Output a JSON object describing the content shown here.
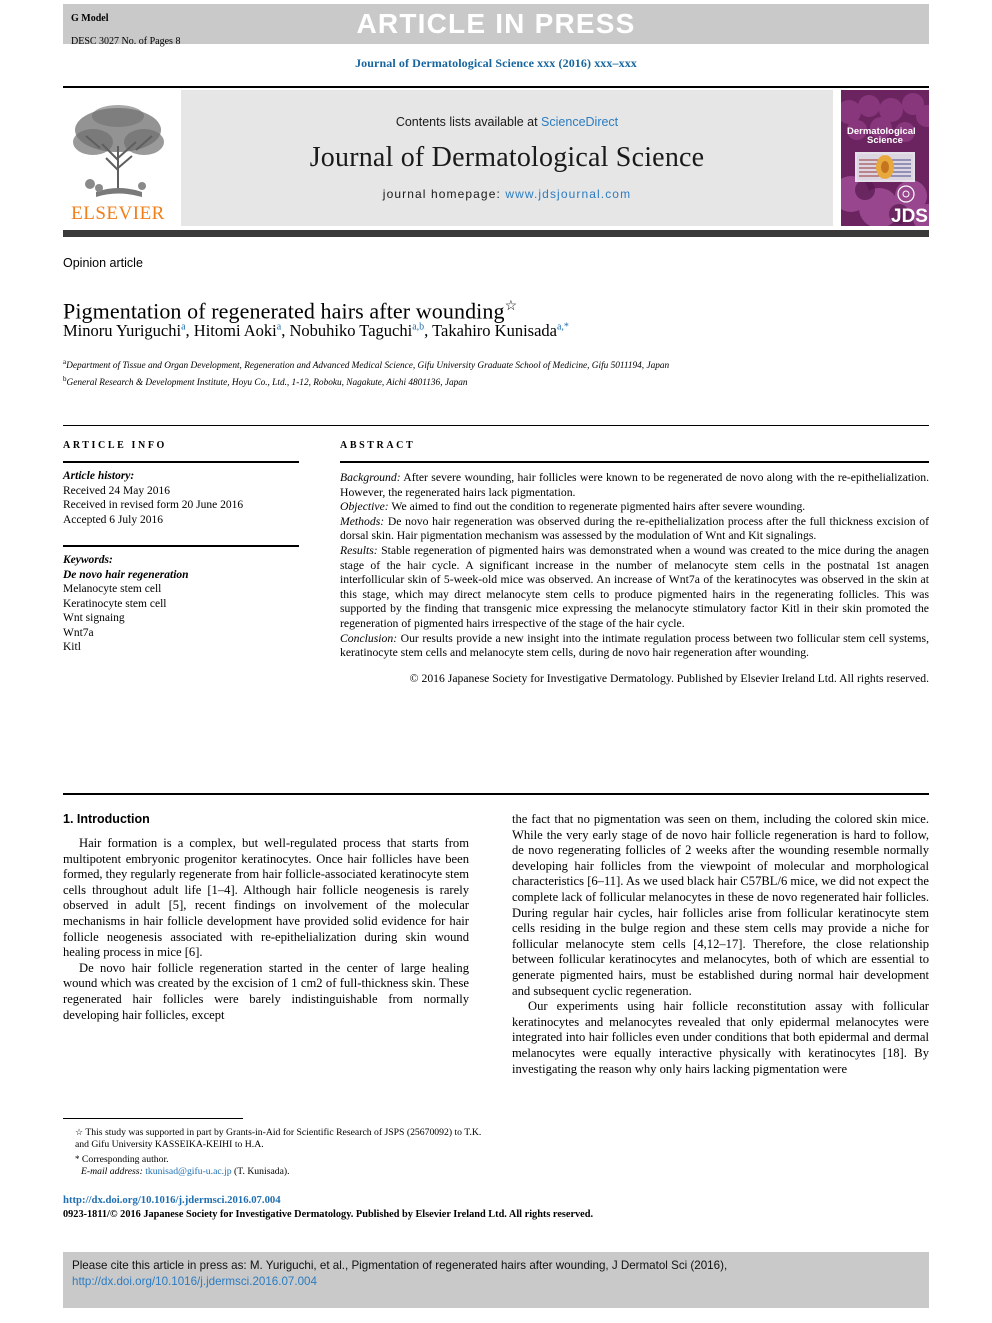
{
  "banner": {
    "g_model": "G Model",
    "doc_id": "DESC 3027 No. of Pages 8",
    "article_in_press": "ARTICLE IN PRESS"
  },
  "running_head": "Journal of Dermatological Science xxx (2016) xxx–xxx",
  "masthead": {
    "publisher": "ELSEVIER",
    "contents_prefix": "Contents lists available at ",
    "contents_link": "ScienceDirect",
    "journal_title": "Journal of Dermatological Science",
    "homepage_prefix": "journal homepage: ",
    "homepage_url": "www.jdsjournal.com",
    "cover_title_line1": "Dermatological",
    "cover_title_line2": "Science",
    "cover_abbrev": "JDS"
  },
  "article": {
    "type": "Opinion article",
    "title": "Pigmentation of regenerated hairs after wounding",
    "title_marker": "☆",
    "authors": [
      {
        "name": "Minoru Yuriguchi",
        "sup": "a",
        "sep": ", "
      },
      {
        "name": "Hitomi Aoki",
        "sup": "a",
        "sep": ", "
      },
      {
        "name": "Nobuhiko Taguchi",
        "sup": "a,b",
        "sep": ", "
      },
      {
        "name": "Takahiro Kunisada",
        "sup": "a,*",
        "sep": ""
      }
    ],
    "affiliations": [
      {
        "marker": "a",
        "text": "Department of Tissue and Organ Development, Regeneration and Advanced Medical Science, Gifu University Graduate School of Medicine, Gifu 5011194, Japan"
      },
      {
        "marker": "b",
        "text": "General Research & Development Institute, Hoyu Co., Ltd., 1-12, Roboku, Nagakute, Aichi 4801136, Japan"
      }
    ]
  },
  "article_info": {
    "heading": "ARTICLE INFO",
    "history_label": "Article history:",
    "history": [
      "Received 24 May 2016",
      "Received in revised form 20 June 2016",
      "Accepted 6 July 2016"
    ],
    "keywords_label": "Keywords:",
    "keywords": [
      "De novo hair regeneration",
      "Melanocyte stem cell",
      "Keratinocyte stem cell",
      "Wnt signaing",
      "Wnt7a",
      "Kitl"
    ]
  },
  "abstract": {
    "heading": "ABSTRACT",
    "sections": [
      {
        "label": "Background:",
        "text": " After severe wounding, hair follicles were known to be regenerated de novo along with the re-epithelialization. However, the regenerated hairs lack pigmentation."
      },
      {
        "label": "Objective:",
        "text": " We aimed to find out the condition to regenerate pigmented hairs after severe wounding."
      },
      {
        "label": "Methods:",
        "text": " De novo hair regeneration was observed during the re-epithelialization process after the full thickness excision of dorsal skin. Hair pigmentation mechanism was assessed by the modulation of Wnt and Kit signalings."
      },
      {
        "label": "Results:",
        "text": " Stable regeneration of pigmented hairs was demonstrated when a wound was created to the mice during the anagen stage of the hair cycle. A significant increase in the number of melanocyte stem cells in the postnatal 1st anagen interfollicular skin of 5-week-old mice was observed. An increase of Wnt7a of the keratinocytes was observed in the skin at this stage, which may direct melanocyte stem cells to produce pigmented hairs in the regenerating follicles. This was supported by the finding that transgenic mice expressing the melanocyte stimulatory factor Kitl in their skin promoted the regeneration of pigmented hairs irrespective of the stage of the hair cycle."
      },
      {
        "label": "Conclusion:",
        "text": " Our results provide a new insight into the intimate regulation process between two follicular stem cell systems, keratinocyte stem cells and melanocyte stem cells, during de novo hair regeneration after wounding."
      }
    ],
    "copyright": "© 2016 Japanese Society for Investigative Dermatology. Published by Elsevier Ireland Ltd. All rights reserved."
  },
  "body": {
    "section_heading": "1. Introduction",
    "left_paragraphs": [
      "Hair formation is a complex, but well-regulated process that starts from multipotent embryonic progenitor keratinocytes. Once hair follicles have been formed, they regularly regenerate from hair follicle-associated keratinocyte stem cells throughout adult life [1–4]. Although hair follicle neogenesis is rarely observed in adult [5], recent findings on involvement of the molecular mechanisms in hair follicle development have provided solid evidence for hair follicle neogenesis associated with re-epithelialization during skin wound healing process in mice [6].",
      "De novo hair follicle regeneration started in the center of large healing wound which was created by the excision of 1 cm2 of full-thickness skin. These regenerated hair follicles were barely indistinguishable from normally developing hair follicles, except"
    ],
    "right_paragraphs": [
      "the fact that no pigmentation was seen on them, including the colored skin mice. While the very early stage of de novo hair follicle regeneration is hard to follow, de novo regenerating follicles of 2 weeks after the wounding resemble normally developing hair follicles from the viewpoint of molecular and morphological characteristics [6–11]. As we used black hair C57BL/6 mice, we did not expect the complete lack of follicular melanocytes in these de novo regenerated hair follicles. During regular hair cycles, hair follicles arise from follicular keratinocyte stem cells residing in the bulge region and these stem cells may provide a niche for follicular melanocyte stem cells [4,12–17]. Therefore, the close relationship between follicular keratinocytes and melanocytes, both of which are essential to generate pigmented hairs, must be established during normal hair development and subsequent cyclic regeneration.",
      "Our experiments using hair follicle reconstitution assay with follicular keratinocytes and melanocytes revealed that only epidermal melanocytes were integrated into hair follicles even under conditions that both epidermal and dermal melanocytes were equally interactive physically with keratinocytes [18]. By investigating the reason why only hairs lacking pigmentation were"
    ]
  },
  "footnotes": {
    "funding_marker": "☆",
    "funding": "This study was supported in part by Grants-in-Aid for Scientific Research of JSPS (25670092) to T.K. and Gifu University KASSEIKA-KEIHI to H.A.",
    "corresponding_marker": "*",
    "corresponding": "Corresponding author.",
    "email_label": "E-mail address:",
    "email": "tkunisad@gifu-u.ac.jp",
    "email_owner": "(T. Kunisada)."
  },
  "doi_block": {
    "doi_url": "http://dx.doi.org/10.1016/j.jdermsci.2016.07.004",
    "issn_line": "0923-1811/© 2016 Japanese Society for Investigative Dermatology. Published by Elsevier Ireland Ltd. All rights reserved."
  },
  "citation_box": {
    "text_prefix": "Please cite this article in press as: M. Yuriguchi, et al., Pigmentation of regenerated hairs after wounding, J Dermatol Sci (2016), ",
    "link": "http://dx.doi.org/10.1016/j.jdermsci.2016.07.004"
  },
  "colors": {
    "link_blue": "#2b7cc1",
    "header_blue": "#16659e",
    "elsevier_orange": "#f07f1a",
    "banner_grey": "#c9c9c9",
    "masthead_grey": "#e6e6e6",
    "cover_purple": "#5c1f55"
  }
}
